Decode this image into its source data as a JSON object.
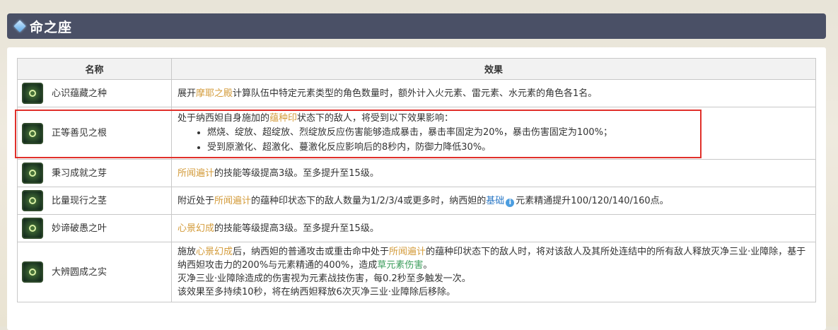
{
  "section": {
    "title": "命之座",
    "header_icon": "diamond-icon"
  },
  "table": {
    "headers": {
      "name": "名称",
      "effect": "效果"
    },
    "rows": [
      {
        "name": "心识蕴藏之种",
        "icon": "constellation-1-icon",
        "effect": {
          "p1": "展开",
          "h1": "摩耶之殿",
          "p2": "计算队伍中特定元素类型的角色数量时，额外计入火元素、雷元素、水元素的角色各1名。"
        }
      },
      {
        "name": "正等善见之根",
        "icon": "constellation-2-icon",
        "effect": {
          "p1": "处于纳西妲自身施加的",
          "h1": "蕴种印",
          "p2": "状态下的敌人，将受到以下效果影响：",
          "bullets": [
            "燃烧、绽放、超绽放、烈绽放反应伤害能够造成暴击，暴击率固定为20%，暴击伤害固定为100%；",
            "受到原激化、超激化、蔓激化反应影响后的8秒内，防御力降低30%。"
          ]
        }
      },
      {
        "name": "秉习成就之芽",
        "icon": "constellation-3-icon",
        "effect": {
          "h1": "所闻遍计",
          "p2": "的技能等级提高3级。至多提升至15级。"
        }
      },
      {
        "name": "比量现行之茎",
        "icon": "constellation-4-icon",
        "effect": {
          "p1": "附近处于",
          "h1": "所闻遍计",
          "p2": "的蕴种印状态下的敌人数量为1/2/3/4或更多时，纳西妲的",
          "link": "基础",
          "info": "i",
          "p3": "元素精通提升100/120/140/160点。"
        }
      },
      {
        "name": "妙谛破愚之叶",
        "icon": "constellation-5-icon",
        "effect": {
          "h1": "心景幻成",
          "p2": "的技能等级提高3级。至多提升至15级。"
        }
      },
      {
        "name": "大辨圆成之实",
        "icon": "constellation-6-icon",
        "effect": {
          "p1": "施放",
          "h1": "心景幻成",
          "p2": "后，纳西妲的普通攻击或重击命中处于",
          "h2": "所闻遍计",
          "p3": "的蕴种印状态下的敌人时，将对该敌人及其所处连结中的所有敌人释放灭净三业·业障除，基于纳西妲攻击力的200%与元素精通的400%，造成",
          "g1": "草元素伤害",
          "p4": "。",
          "l2": "灭净三业·业障除造成的伤害视为元素战技伤害，每0.2秒至多触发一次。",
          "l3": "该效果至多持续10秒，将在纳西妲释放6次灭净三业·业障除后移除。"
        }
      }
    ]
  },
  "colors": {
    "header_bg": "#4a5066",
    "highlight": "#d39b3a",
    "dendro": "#3a9c5a",
    "link": "#2b78c5",
    "box": "#e0302a"
  }
}
